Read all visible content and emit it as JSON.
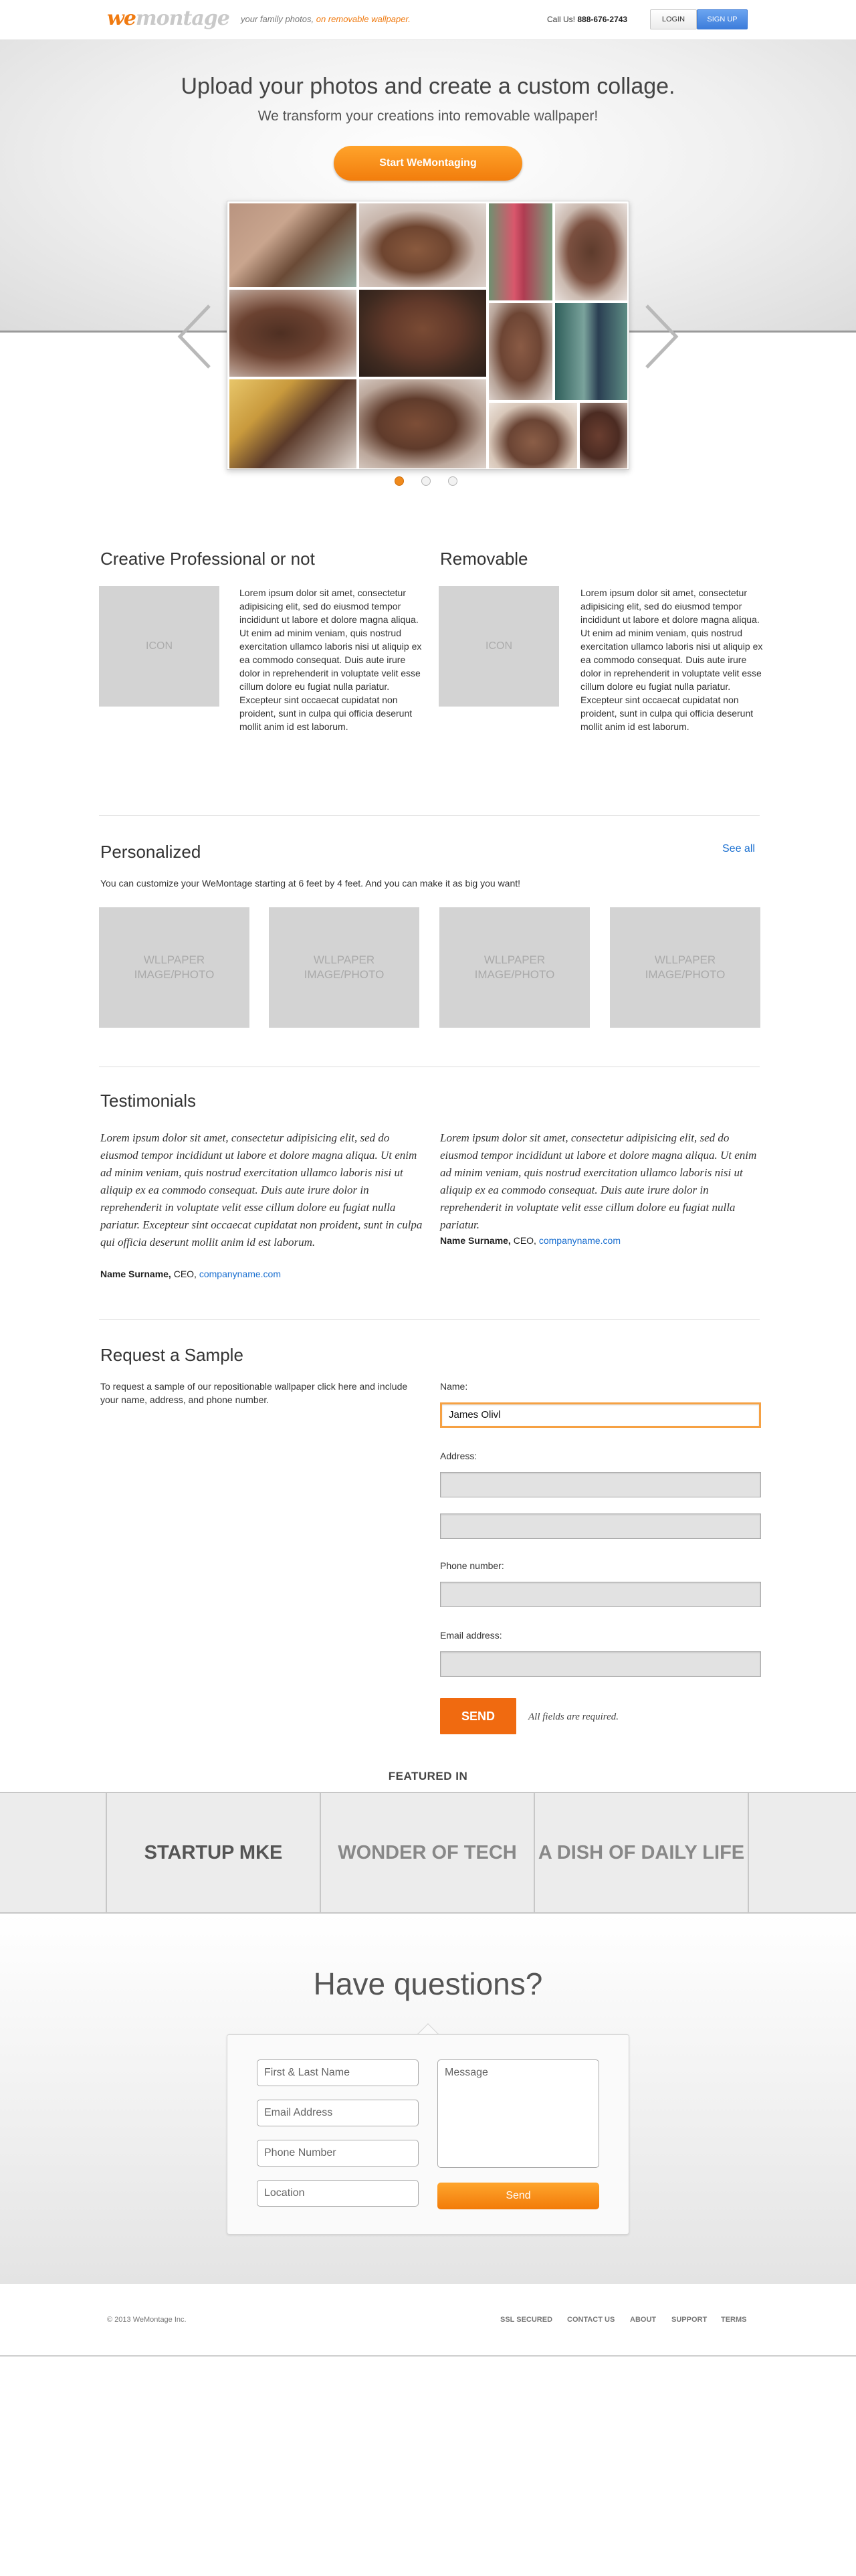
{
  "header": {
    "logo_we": "we",
    "logo_rest": "montage",
    "tagline": "your family photos,",
    "tagline_highlight": "on removable wallpaper.",
    "call_label": "Call Us!",
    "phone": "888-676-2743",
    "login": "LOGIN",
    "signup": "SIGN UP"
  },
  "hero": {
    "title": "Upload your photos and create a custom collage.",
    "subtitle": "We transform your creations into removable wallpaper!",
    "cta": "Start WeMontaging"
  },
  "features": [
    {
      "title": "Creative Professional or not",
      "icon_label": "ICON",
      "text": "Lorem ipsum dolor sit amet, consectetur adipisicing elit, sed do eiusmod tempor incididunt ut labore et dolore magna aliqua. Ut enim ad minim veniam, quis nostrud exercitation ullamco laboris nisi ut aliquip ex ea commodo consequat. Duis aute irure dolor in reprehenderit in voluptate velit esse cillum dolore eu fugiat nulla pariatur. Excepteur sint occaecat cupidatat non proident, sunt in culpa qui officia deserunt mollit anim id est laborum."
    },
    {
      "title": "Removable",
      "icon_label": "ICON",
      "text": "Lorem ipsum dolor sit amet, consectetur adipisicing elit, sed do eiusmod tempor incididunt ut labore et dolore magna aliqua. Ut enim ad minim veniam, quis nostrud exercitation ullamco laboris nisi ut aliquip ex ea commodo consequat. Duis aute irure dolor in reprehenderit in voluptate velit esse cillum dolore eu fugiat nulla pariatur. Excepteur sint occaecat cupidatat non proident, sunt in culpa qui officia deserunt mollit anim id est laborum."
    }
  ],
  "personalized": {
    "title": "Personalized",
    "see_all": "See all",
    "description": "You can customize your WeMontage starting at 6 feet by 4 feet. And you can make it as big you want!",
    "placeholders": [
      {
        "line1": "WLLPAPER",
        "line2": "IMAGE/PHOTO"
      },
      {
        "line1": "WLLPAPER",
        "line2": "IMAGE/PHOTO"
      },
      {
        "line1": "WLLPAPER",
        "line2": "IMAGE/PHOTO"
      },
      {
        "line1": "WLLPAPER",
        "line2": "IMAGE/PHOTO"
      }
    ]
  },
  "testimonials": {
    "title": "Testimonials",
    "items": [
      {
        "quote": "Lorem ipsum dolor sit amet, consectetur adipisicing elit, sed do eiusmod tempor incididunt ut labore et dolore magna aliqua. Ut enim ad minim veniam, quis nostrud exercitation ullamco laboris nisi ut aliquip ex ea commodo consequat. Duis aute irure dolor in reprehenderit in voluptate velit esse cillum dolore eu fugiat nulla pariatur. Excepteur sint occaecat cupidatat non proident, sunt in culpa qui officia deserunt mollit anim id est laborum.",
        "name": "Name Surname,",
        "role": " CEO, ",
        "company": "companyname.com"
      },
      {
        "quote": "Lorem ipsum dolor sit amet, consectetur adipisicing elit, sed do eiusmod tempor incididunt ut labore et dolore magna aliqua. Ut enim ad minim veniam, quis nostrud exercitation ullamco laboris nisi ut aliquip ex ea commodo consequat. Duis aute irure dolor in reprehenderit in voluptate velit esse cillum dolore eu fugiat nulla pariatur.",
        "name": "Name Surname,",
        "role": " CEO, ",
        "company": "companyname.com"
      }
    ]
  },
  "sample": {
    "title": "Request a Sample",
    "description": "To request a sample of our repositionable wallpaper click here and include your name, address, and phone number.",
    "name_label": "Name:",
    "name_value": "James Olivl",
    "address_label": "Address:",
    "phone_label": "Phone number:",
    "email_label": "Email address:",
    "send": "SEND",
    "required_note": "All fields are required."
  },
  "featured": {
    "label": "FEATURED IN",
    "items": [
      "STARTUP MKE",
      "WONDER OF TECH",
      "A DISH OF DAILY LIFE"
    ]
  },
  "questions": {
    "title": "Have questions?",
    "name_placeholder": "First & Last Name",
    "email_placeholder": "Email Address",
    "phone_placeholder": "Phone Number",
    "location_placeholder": "Location",
    "message_placeholder": "Message",
    "send": "Send"
  },
  "footer": {
    "copyright": "© 2013 WeMontage Inc.",
    "links": [
      "SSL SECURED",
      "CONTACT US",
      "ABOUT",
      "SUPPORT",
      "TERMS"
    ]
  },
  "colors": {
    "accent_orange": "#f07a10",
    "link_blue": "#1a6fd0",
    "signup_blue": "#3d7ddb"
  }
}
